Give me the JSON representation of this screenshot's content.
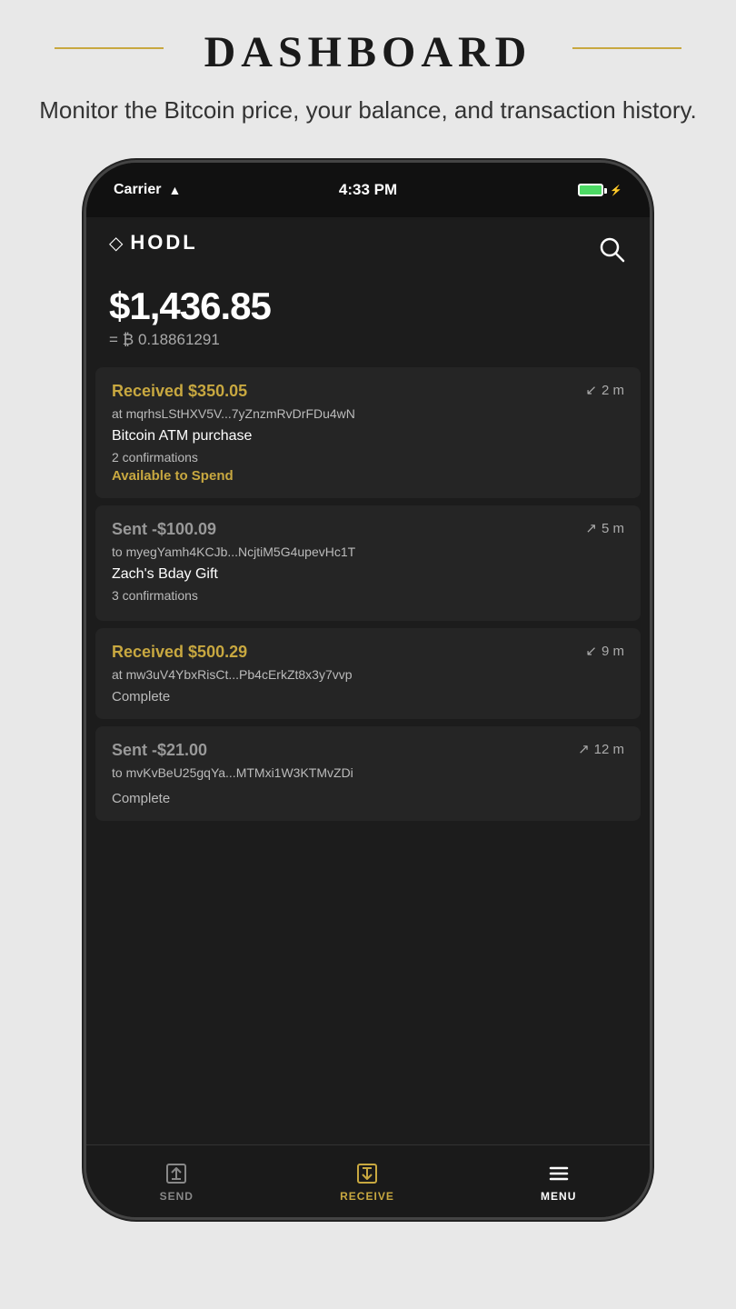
{
  "page": {
    "title": "DASHBOARD",
    "subtitle": "Monitor the Bitcoin price, your balance, and transaction history."
  },
  "status_bar": {
    "carrier": "Carrier",
    "time": "4:33 PM"
  },
  "app": {
    "logo_text": "HODL",
    "balance_usd": "$1,436.85",
    "balance_btc": "= ₿ 0.18861291"
  },
  "transactions": [
    {
      "type": "received",
      "amount": "Received $350.05",
      "address": "at mqrhsLStHXV5V...7yZnzmRvDrFDu4wN",
      "label": "Bitcoin ATM purchase",
      "confirmations": "2 confirmations",
      "status": "Available to Spend",
      "time": "2 m"
    },
    {
      "type": "sent",
      "amount": "Sent -$100.09",
      "address": "to myegYamh4KCJb...NcjtiM5G4upevHc1T",
      "label": "Zach's Bday Gift",
      "confirmations": "3 confirmations",
      "status": "",
      "time": "5 m"
    },
    {
      "type": "received",
      "amount": "Received $500.29",
      "address": "at mw3uV4YbxRisCt...Pb4cErkZt8x3y7vvp",
      "label": "",
      "confirmations": "",
      "status": "Complete",
      "time": "9 m"
    },
    {
      "type": "sent",
      "amount": "Sent -$21.00",
      "address": "to mvKvBeU25gqYa...MTMxi1W3KTMvZDi",
      "label": "",
      "confirmations": "",
      "status": "Complete",
      "time": "12 m"
    }
  ],
  "nav": {
    "send_label": "SEND",
    "receive_label": "RECEIVE",
    "menu_label": "MENU"
  }
}
